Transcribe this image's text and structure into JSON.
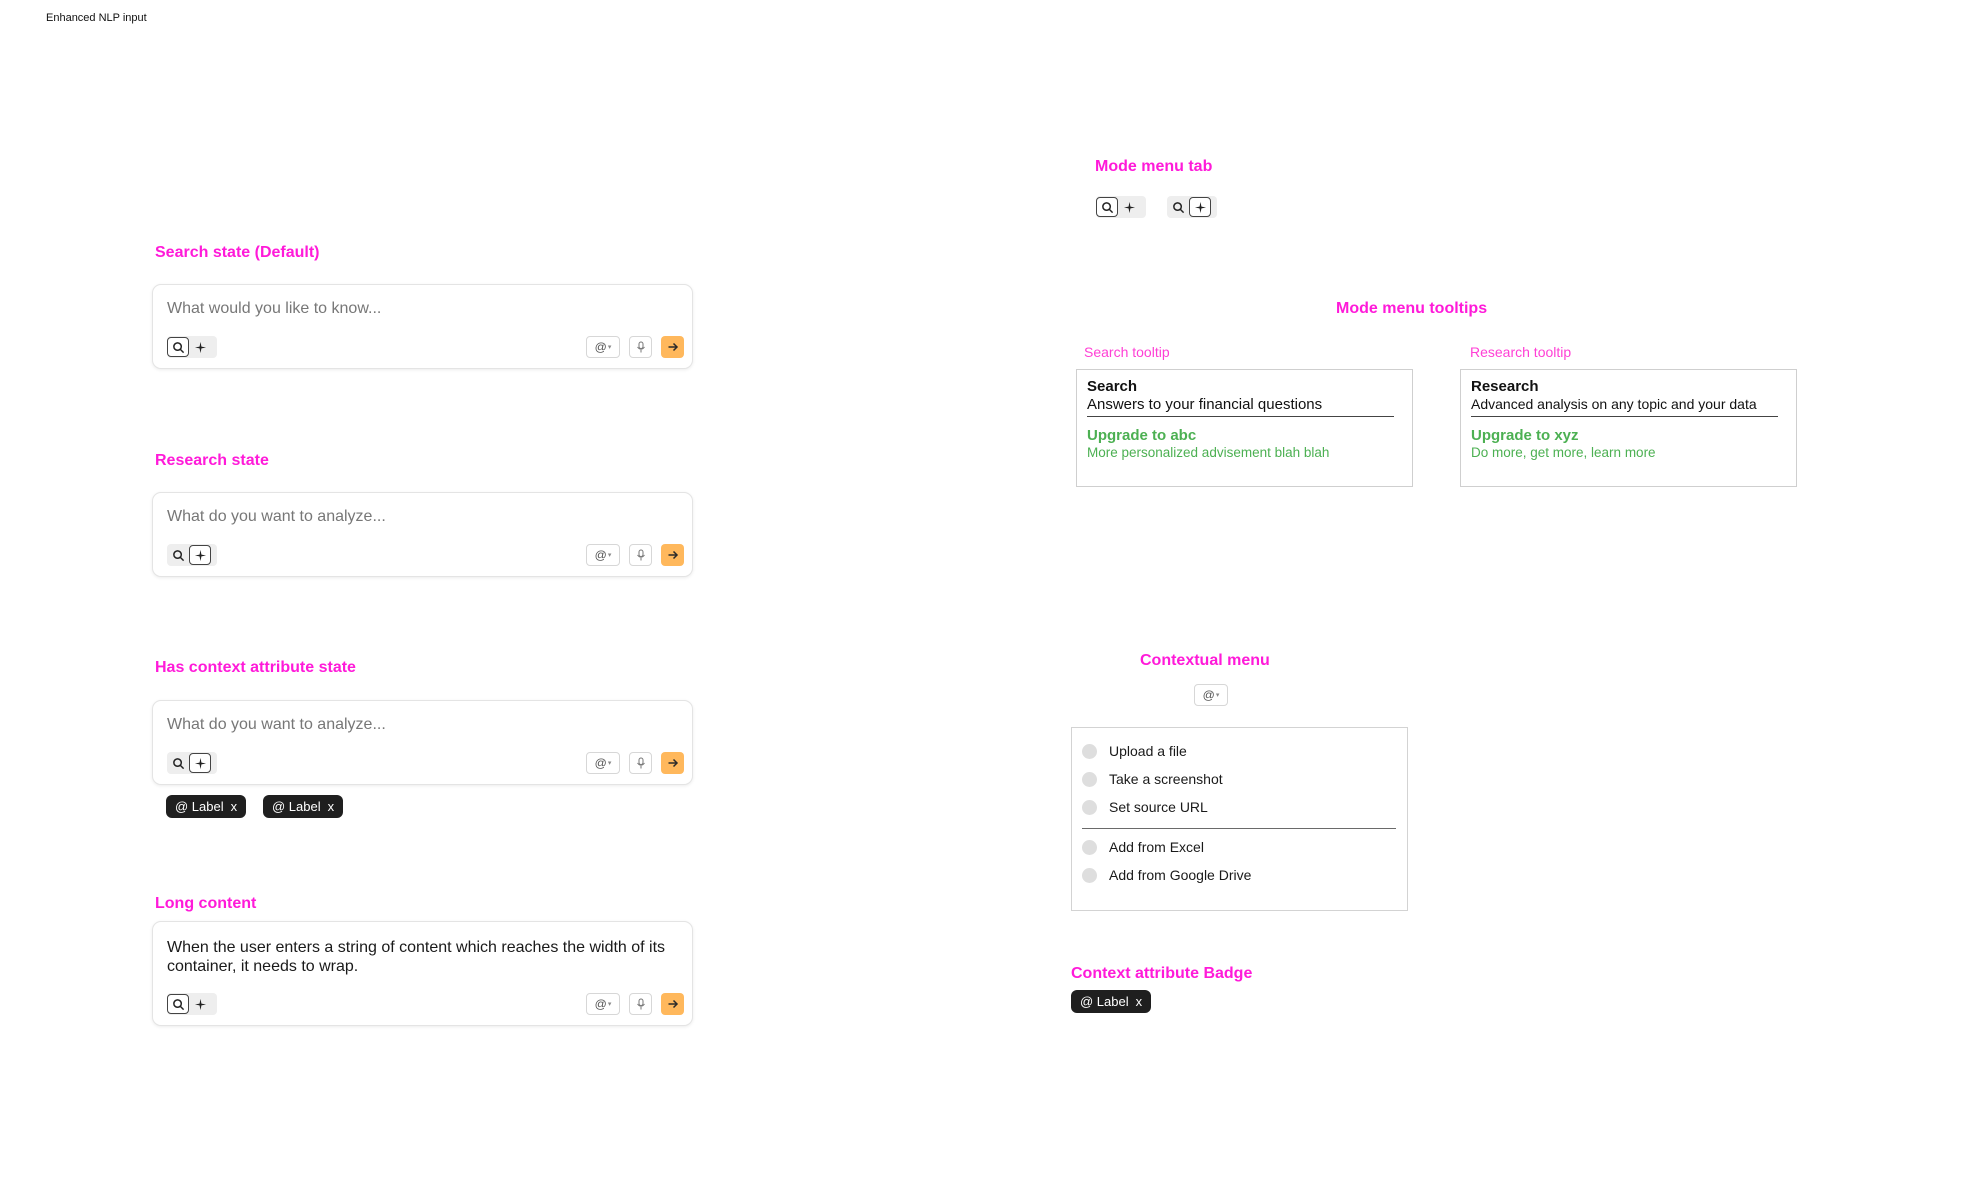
{
  "page": {
    "title": "Enhanced NLP input"
  },
  "sections": {
    "search": {
      "title": "Search state (Default)",
      "placeholder": "What would you like to know..."
    },
    "research": {
      "title": "Research state",
      "placeholder": "What do you want to analyze..."
    },
    "context": {
      "title": "Has context attribute state",
      "placeholder": "What do you want to analyze..."
    },
    "long": {
      "title": "Long content",
      "text": "When the user enters a string of content which reaches the width of its container, it needs to wrap."
    }
  },
  "toolbar": {
    "at_label": "@",
    "at_caret": "▾"
  },
  "badges": [
    {
      "label": "@ Label",
      "close": "x"
    },
    {
      "label": "@ Label",
      "close": "x"
    }
  ],
  "mode_menu_tab": {
    "title": "Mode menu tab"
  },
  "tooltips": {
    "title": "Mode menu tooltips",
    "search": {
      "caption": "Search tooltip",
      "heading": "Search",
      "description": "Answers to your financial questions",
      "upgrade": "Upgrade to abc",
      "upgrade_sub": "More personalized advisement blah blah"
    },
    "research": {
      "caption": "Research tooltip",
      "heading": "Research",
      "description": "Advanced analysis on any topic and your data",
      "upgrade": "Upgrade to xyz",
      "upgrade_sub": "Do more, get more, learn more"
    }
  },
  "contextual_menu": {
    "title": "Contextual menu",
    "items": [
      "Upload a file",
      "Take a screenshot",
      "Set source URL",
      "Add from Excel",
      "Add from Google Drive"
    ]
  },
  "context_badge": {
    "title": "Context attribute Badge",
    "label": "@ Label",
    "close": "x"
  },
  "colors": {
    "accent": "#ff1ad9",
    "send": "#ffb85c",
    "upgrade": "#4cb052",
    "badge": "#1f1f1f"
  },
  "icons": {
    "search": "search-icon",
    "research": "sparkle-icon",
    "mic": "mic-icon",
    "send": "arrow-right-icon",
    "context": "at-icon"
  }
}
